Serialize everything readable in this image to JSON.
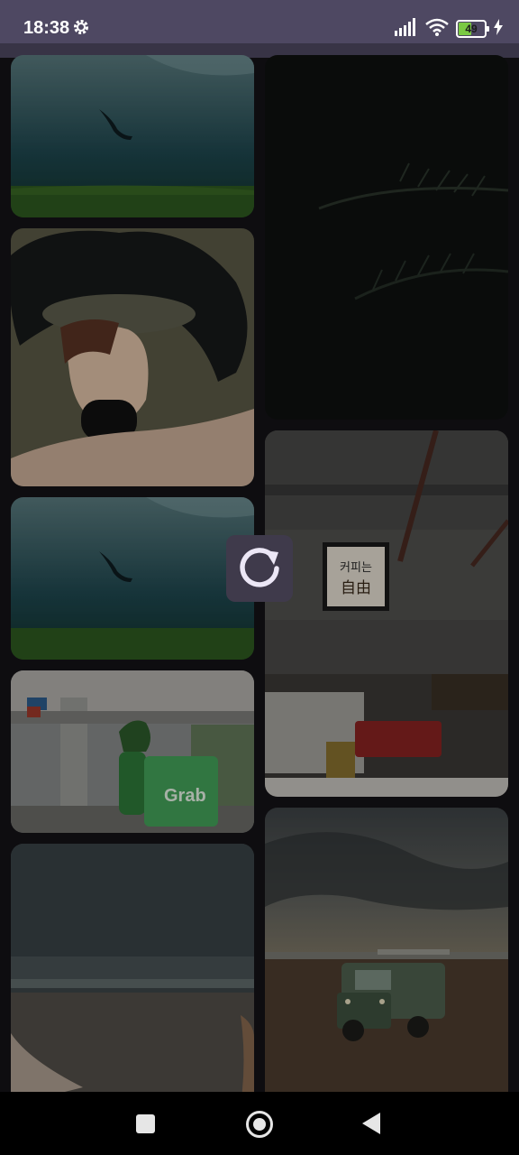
{
  "status_bar": {
    "time": "18:38",
    "battery_level": "49",
    "icons": [
      "gear-icon",
      "signal-icon",
      "wifi-icon",
      "battery-icon",
      "charging-icon"
    ]
  },
  "gallery": {
    "cafe_sign_line1": "커피는",
    "cafe_sign_line2": "自由",
    "delivery_box_text": "Grab",
    "columns": [
      [
        "underwater-diver-photo",
        "woman-hat-painting-photo",
        "underwater-diver-photo",
        "delivery-rider-photo",
        "beach-photo"
      ],
      [
        "dark-pine-branch-photo",
        "cafe-interior-photo",
        "vintage-jeep-photo"
      ]
    ]
  },
  "refresh": {
    "icon": "refresh-icon"
  },
  "nav_bar": {
    "buttons": [
      "recents-button",
      "home-button",
      "back-button"
    ]
  },
  "colors": {
    "status_bar": "#4e4862",
    "background": "#141317",
    "refresh_button": "#3f3a4b",
    "refresh_icon": "#ece7f6"
  }
}
